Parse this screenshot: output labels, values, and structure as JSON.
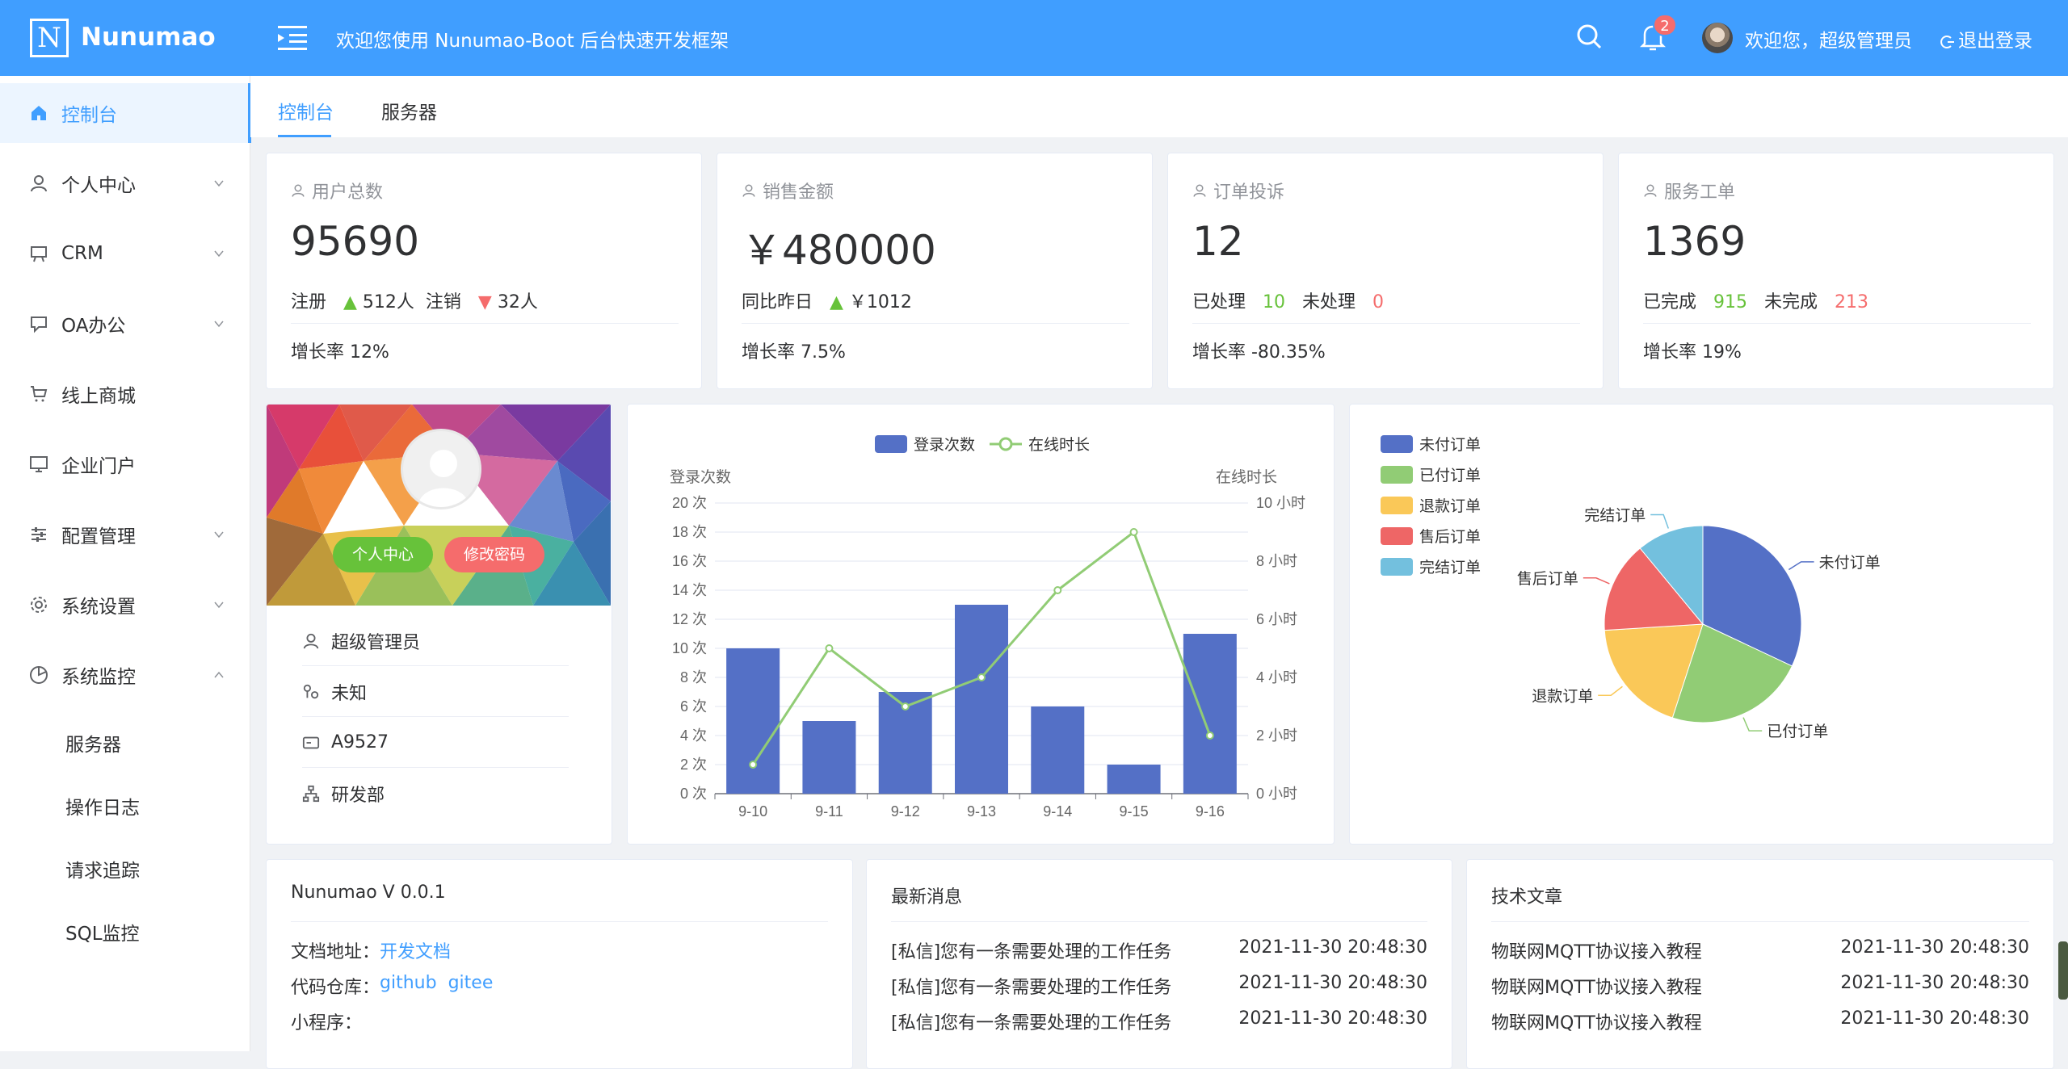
{
  "app": {
    "logo_letter": "N",
    "name": "Nunumao",
    "welcome": "欢迎您使用 Nunumao-Boot 后台快速开发框架",
    "notification_count": "2",
    "user_welcome": "欢迎您，超级管理员",
    "logout": "退出登录"
  },
  "sidebar": {
    "items": [
      {
        "label": "控制台",
        "icon": "home-icon"
      },
      {
        "label": "个人中心",
        "icon": "user-icon"
      },
      {
        "label": "CRM",
        "icon": "board-icon"
      },
      {
        "label": "OA办公",
        "icon": "tray-icon"
      },
      {
        "label": "线上商城",
        "icon": "cart-icon"
      },
      {
        "label": "企业门户",
        "icon": "monitor-icon"
      },
      {
        "label": "配置管理",
        "icon": "sliders-icon"
      },
      {
        "label": "系统设置",
        "icon": "gear-icon"
      },
      {
        "label": "系统监控",
        "icon": "pie-icon"
      }
    ],
    "sub_items": [
      "服务器",
      "操作日志",
      "请求追踪",
      "SQL监控"
    ]
  },
  "tabs": [
    "控制台",
    "服务器"
  ],
  "stats": [
    {
      "label": "用户总数",
      "value": "95690",
      "a_label": "注册",
      "a_value": "512人",
      "b_label": "注销",
      "b_value": "32人",
      "rate": "增长率 12%"
    },
    {
      "label": "销售金额",
      "value": "￥480000",
      "a_label": "同比昨日",
      "a_value": "￥1012",
      "rate": "增长率 7.5%"
    },
    {
      "label": "订单投诉",
      "value": "12",
      "a_label": "已处理",
      "a_value": "10",
      "b_label": "未处理",
      "b_value": "0",
      "rate": "增长率 -80.35%"
    },
    {
      "label": "服务工单",
      "value": "1369",
      "a_label": "已完成",
      "a_value": "915",
      "b_label": "未完成",
      "b_value": "213",
      "rate": "增长率 19%"
    }
  ],
  "profile": {
    "btn_center": "个人中心",
    "btn_password": "修改密码",
    "name": "超级管理员",
    "gender": "未知",
    "code": "A9527",
    "dept": "研发部"
  },
  "chart_data": [
    {
      "type": "bar",
      "categories": [
        "9-10",
        "9-11",
        "9-12",
        "9-13",
        "9-14",
        "9-15",
        "9-16"
      ],
      "series": [
        {
          "name": "登录次数",
          "type": "bar",
          "axis": "left",
          "values": [
            10,
            5,
            7,
            13,
            6,
            2,
            11
          ],
          "color": "#5470c6"
        },
        {
          "name": "在线时长",
          "type": "line",
          "axis": "right",
          "values": [
            1,
            5,
            3,
            4,
            7,
            9,
            2
          ],
          "color": "#91cc75"
        }
      ],
      "ylabel": "登录次数",
      "y2label": "在线时长",
      "ylim": [
        0,
        20
      ],
      "y2lim": [
        0,
        10
      ],
      "yticks": [
        "0 次",
        "2 次",
        "4 次",
        "6 次",
        "8 次",
        "10 次",
        "12 次",
        "14 次",
        "16 次",
        "18 次",
        "20 次"
      ],
      "y2ticks": [
        "0 小时",
        "2 小时",
        "4 小时",
        "6 小时",
        "8 小时",
        "10 小时"
      ],
      "legend": "top-center",
      "grid": true
    },
    {
      "type": "pie",
      "categories": [
        "未付订单",
        "已付订单",
        "退款订单",
        "售后订单",
        "完结订单"
      ],
      "values": [
        32,
        23,
        19,
        15,
        11
      ],
      "colors": [
        "#5470c6",
        "#91cc75",
        "#fac858",
        "#ee6666",
        "#73c0de"
      ],
      "legend": "top-left"
    }
  ],
  "about": {
    "title": "Nunumao V 0.0.1",
    "doc_label": "文档地址：",
    "doc_link": "开发文档",
    "repo_label": "代码仓库：",
    "repo_github": "github",
    "repo_gitee": "gitee",
    "mini_label": "小程序："
  },
  "news": {
    "title": "最新消息",
    "rows": [
      {
        "text": "[私信]您有一条需要处理的工作任务",
        "time": "2021-11-30 20:48:30"
      },
      {
        "text": "[私信]您有一条需要处理的工作任务",
        "time": "2021-11-30 20:48:30"
      },
      {
        "text": "[私信]您有一条需要处理的工作任务",
        "time": "2021-11-30 20:48:30"
      }
    ]
  },
  "articles": {
    "title": "技术文章",
    "rows": [
      {
        "text": "物联网MQTT协议接入教程",
        "time": "2021-11-30 20:48:30"
      },
      {
        "text": "物联网MQTT协议接入教程",
        "time": "2021-11-30 20:48:30"
      },
      {
        "text": "物联网MQTT协议接入教程",
        "time": "2021-11-30 20:48:30"
      }
    ]
  }
}
